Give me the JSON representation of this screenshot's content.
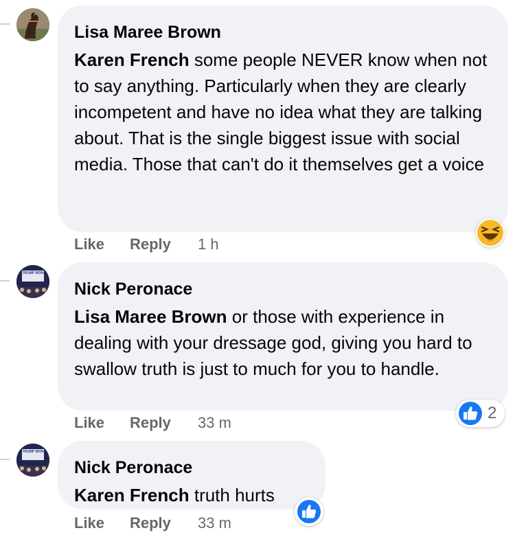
{
  "comments": [
    {
      "author": "Lisa Maree Brown",
      "mention": "Karen French",
      "text": "some people NEVER know when not to say anything. Particularly when they are clearly incompetent and have no idea what they are talking about. That is the single biggest issue with social media. Those that can't do it themselves get a voice",
      "like_label": "Like",
      "reply_label": "Reply",
      "time": "1 h",
      "reaction": {
        "type": "haha",
        "icon": "haha-emoji-icon",
        "count": ""
      }
    },
    {
      "author": "Nick Peronace",
      "avatar_text": "TRUMP WON",
      "mention": "Lisa Maree Brown",
      "text": "or those with experience in dealing with your dressage god, giving you hard to swallow truth is just to much for you to handle.",
      "like_label": "Like",
      "reply_label": "Reply",
      "time": "33 m",
      "reaction": {
        "type": "like",
        "icon": "thumbs-up-icon",
        "count": "2"
      }
    },
    {
      "author": "Nick Peronace",
      "avatar_text": "TRUMP WON",
      "mention": "Karen French",
      "text": "truth hurts",
      "like_label": "Like",
      "reply_label": "Reply",
      "time": "33 m",
      "reaction": {
        "type": "like",
        "icon": "thumbs-up-icon",
        "count": ""
      }
    }
  ],
  "colors": {
    "bubble": "#f0f2f5",
    "meta": "#65676b",
    "like_blue": "#1877f2",
    "haha_yellow": "#f7b928"
  }
}
